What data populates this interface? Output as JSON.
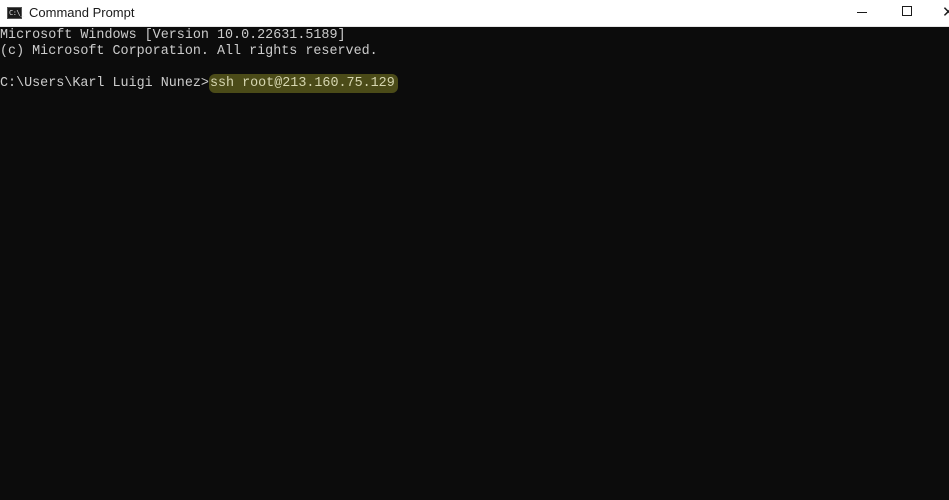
{
  "window": {
    "title": "Command Prompt",
    "app_icon": "cmd-icon",
    "app_icon_glyph": "C:\\_",
    "controls": {
      "minimize": "minimize-icon",
      "maximize": "maximize-icon",
      "close": "close-icon",
      "close_glyph": "✕"
    }
  },
  "console": {
    "lines": [
      "Microsoft Windows [Version 10.0.22631.5189]",
      "(c) Microsoft Corporation. All rights reserved.",
      ""
    ],
    "prompt": "C:\\Users\\Karl Luigi Nunez>",
    "command": "ssh root@213.160.75.129",
    "colors": {
      "background": "#0c0c0c",
      "text": "#cccccc",
      "highlight": "#4b4b18"
    }
  }
}
